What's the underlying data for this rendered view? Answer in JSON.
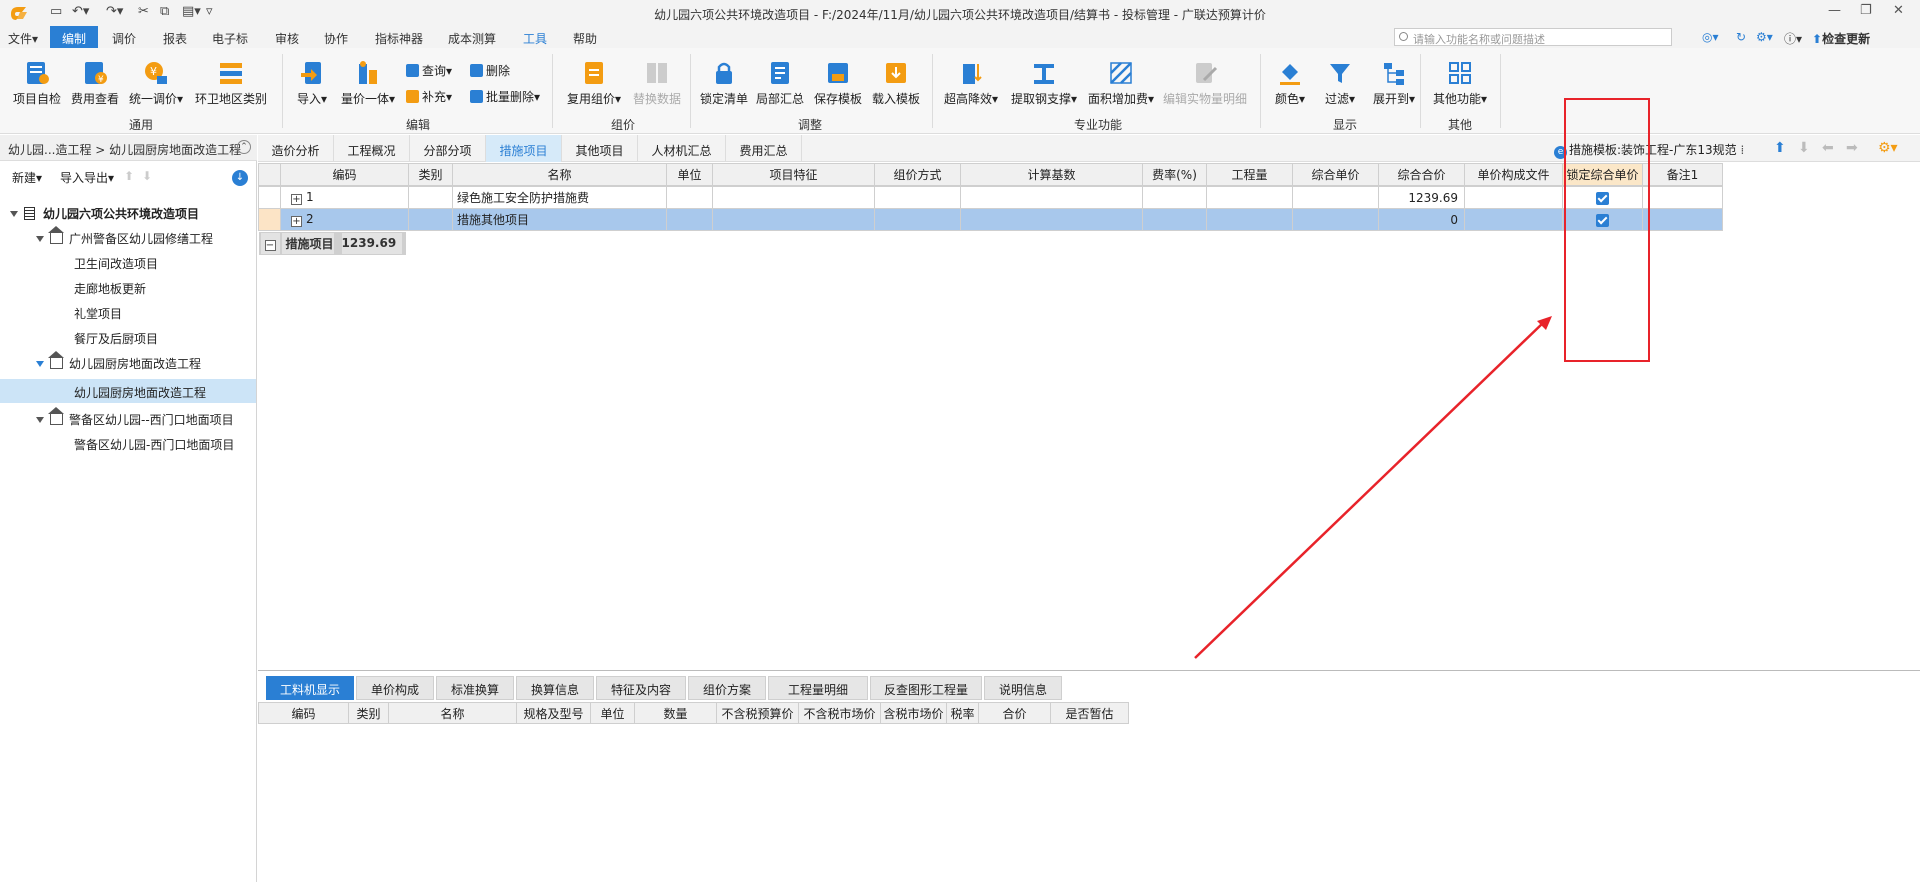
{
  "title": "幼儿园六项公共环境改造项目 - F:/2024年/11月/幼儿园六项公共环境改造项目/结算书 - 投标管理 - 广联达预算计价",
  "menu": {
    "file": "文件▾",
    "items": [
      "编制",
      "调价",
      "报表",
      "电子标",
      "审核",
      "协作",
      "指标神器",
      "成本测算",
      "工具",
      "帮助"
    ],
    "search_placeholder": "请输入功能名称或问题描述",
    "update": "检查更新"
  },
  "ribbon": {
    "general": {
      "label": "通用",
      "buttons": [
        "项目自检",
        "费用查看",
        "统一调价▾",
        "环卫地区类别"
      ]
    },
    "edit": {
      "label": "编辑",
      "buttons": [
        "导入▾",
        "量价一体▾"
      ],
      "small": [
        "查询▾",
        "补充▾",
        "删除",
        "批量删除▾"
      ]
    },
    "group": {
      "label": "组价",
      "buttons": [
        "复用组价▾",
        "替换数据"
      ]
    },
    "adjust": {
      "label": "调整",
      "buttons": [
        "锁定清单",
        "局部汇总",
        "保存模板",
        "载入模板"
      ]
    },
    "pro": {
      "label": "专业功能",
      "buttons": [
        "超高降效▾",
        "提取钢支撑▾",
        "面积增加费▾",
        "编辑实物量明细"
      ]
    },
    "display": {
      "label": "显示",
      "buttons": [
        "颜色▾",
        "过滤▾",
        "展开到▾"
      ]
    },
    "other": {
      "label": "其他",
      "buttons": [
        "其他功能▾"
      ]
    }
  },
  "left": {
    "breadcrumb": "幼儿园...造工程 > 幼儿园厨房地面改造工程",
    "toolbar": [
      "新建▾",
      "导入导出▾"
    ],
    "tree": [
      {
        "label": "幼儿园六项公共环境改造项目"
      },
      {
        "label": "广州警备区幼儿园修缮工程"
      },
      {
        "label": "卫生间改造项目"
      },
      {
        "label": "走廊地板更新"
      },
      {
        "label": "礼堂项目"
      },
      {
        "label": "餐厅及后厨项目"
      },
      {
        "label": "幼儿园厨房地面改造工程"
      },
      {
        "label": "幼儿园厨房地面改造工程"
      },
      {
        "label": "警备区幼儿园--西门口地面项目"
      },
      {
        "label": "警备区幼儿园-西门口地面项目"
      }
    ]
  },
  "tabs": [
    "造价分析",
    "工程概况",
    "分部分项",
    "措施项目",
    "其他项目",
    "人材机汇总",
    "费用汇总"
  ],
  "template_label": "措施模板:装饰工程-广东13规范",
  "grid": {
    "headers": [
      "编码",
      "类别",
      "名称",
      "单位",
      "项目特征",
      "组价方式",
      "计算基数",
      "费率(%)",
      "工程量",
      "综合单价",
      "综合合价",
      "单价构成文件",
      "锁定综合单价",
      "备注1"
    ],
    "group_row": {
      "name": "措施项目",
      "total": "1239.69"
    },
    "rows": [
      {
        "code": "1",
        "name": "绿色施工安全防护措施费",
        "total": "1239.69"
      },
      {
        "code": "2",
        "name": "措施其他项目",
        "total": "0"
      }
    ]
  },
  "bottom": {
    "tabs": [
      "工料机显示",
      "单价构成",
      "标准换算",
      "换算信息",
      "特征及内容",
      "组价方案",
      "工程量明细",
      "反查图形工程量",
      "说明信息"
    ],
    "headers": [
      "编码",
      "类别",
      "名称",
      "规格及型号",
      "单位",
      "数量",
      "不含税预算价",
      "不含税市场价",
      "含税市场价",
      "税率",
      "合价",
      "是否暂估"
    ]
  },
  "colors": {
    "accent": "#2a7fd4",
    "annotation": "#e8232a",
    "selected_row": "#a8c8ec"
  }
}
